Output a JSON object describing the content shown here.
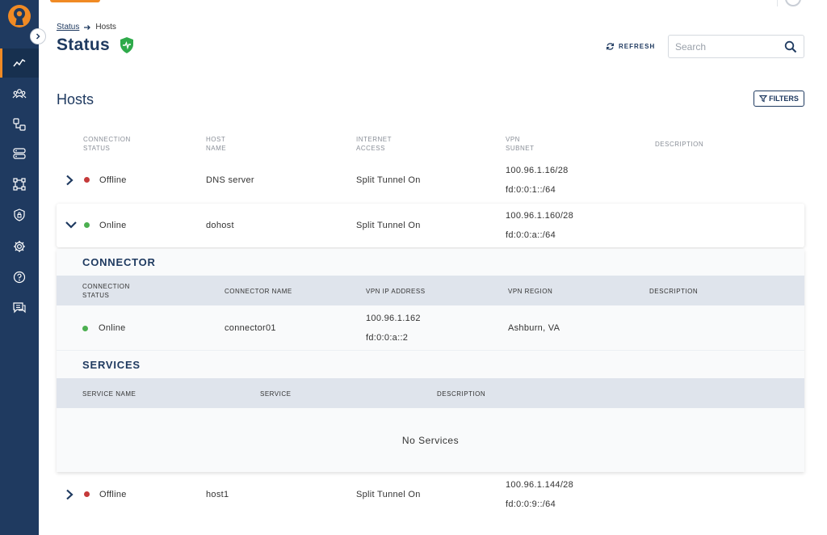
{
  "nav": {
    "items": [
      {
        "icon": "activity-chart-icon",
        "active": true
      },
      {
        "icon": "users-icon"
      },
      {
        "icon": "network-icon"
      },
      {
        "icon": "servers-icon"
      },
      {
        "icon": "topology-icon"
      },
      {
        "icon": "shield-lock-icon"
      },
      {
        "icon": "gear-icon"
      },
      {
        "icon": "help-circle-icon"
      },
      {
        "icon": "chat-icon"
      }
    ]
  },
  "breadcrumb": {
    "parent": "Status",
    "current": "Hosts"
  },
  "page": {
    "title": "Status"
  },
  "toolbar": {
    "refresh_label": "REFRESH",
    "search_placeholder": "Search",
    "search_value": ""
  },
  "hosts": {
    "heading": "Hosts",
    "filters_label": "FILTERS",
    "columns": {
      "status_line1": "CONNECTION",
      "status_line2": "STATUS",
      "host_line1": "HOST",
      "host_line2": "NAME",
      "internet_line1": "INTERNET",
      "internet_line2": "ACCESS",
      "vpn_line1": "VPN",
      "vpn_line2": "SUBNET",
      "description": "DESCRIPTION"
    },
    "rows": [
      {
        "status": "Offline",
        "name": "DNS server",
        "internet": "Split Tunnel On",
        "subnet_v4": "100.96.1.16/28",
        "subnet_v6": "fd:0:0:1::/64",
        "description": ""
      },
      {
        "status": "Online",
        "name": "dohost",
        "internet": "Split Tunnel On",
        "subnet_v4": "100.96.1.160/28",
        "subnet_v6": "fd:0:0:a::/64",
        "description": ""
      },
      {
        "status": "Offline",
        "name": "host1",
        "internet": "Split Tunnel On",
        "subnet_v4": "100.96.1.144/28",
        "subnet_v6": "fd:0:0:9::/64",
        "description": ""
      }
    ]
  },
  "connector": {
    "title": "CONNECTOR",
    "columns": {
      "status_line1": "CONNECTION",
      "status_line2": "STATUS",
      "name": "CONNECTOR NAME",
      "ip": "VPN IP ADDRESS",
      "region": "VPN REGION",
      "description": "DESCRIPTION"
    },
    "row": {
      "status": "Online",
      "name": "connector01",
      "ip_v4": "100.96.1.162",
      "ip_v6": "fd:0:0:a::2",
      "region": "Ashburn, VA",
      "description": ""
    }
  },
  "services": {
    "title": "SERVICES",
    "columns": {
      "name": "SERVICE NAME",
      "service": "SERVICE",
      "description": "DESCRIPTION"
    },
    "empty": "No Services"
  },
  "colors": {
    "sidebar": "#1f3a60",
    "accent": "#f08a24",
    "online": "#4caf50",
    "offline": "#c53a3a",
    "shield": "#2eaa4a"
  }
}
